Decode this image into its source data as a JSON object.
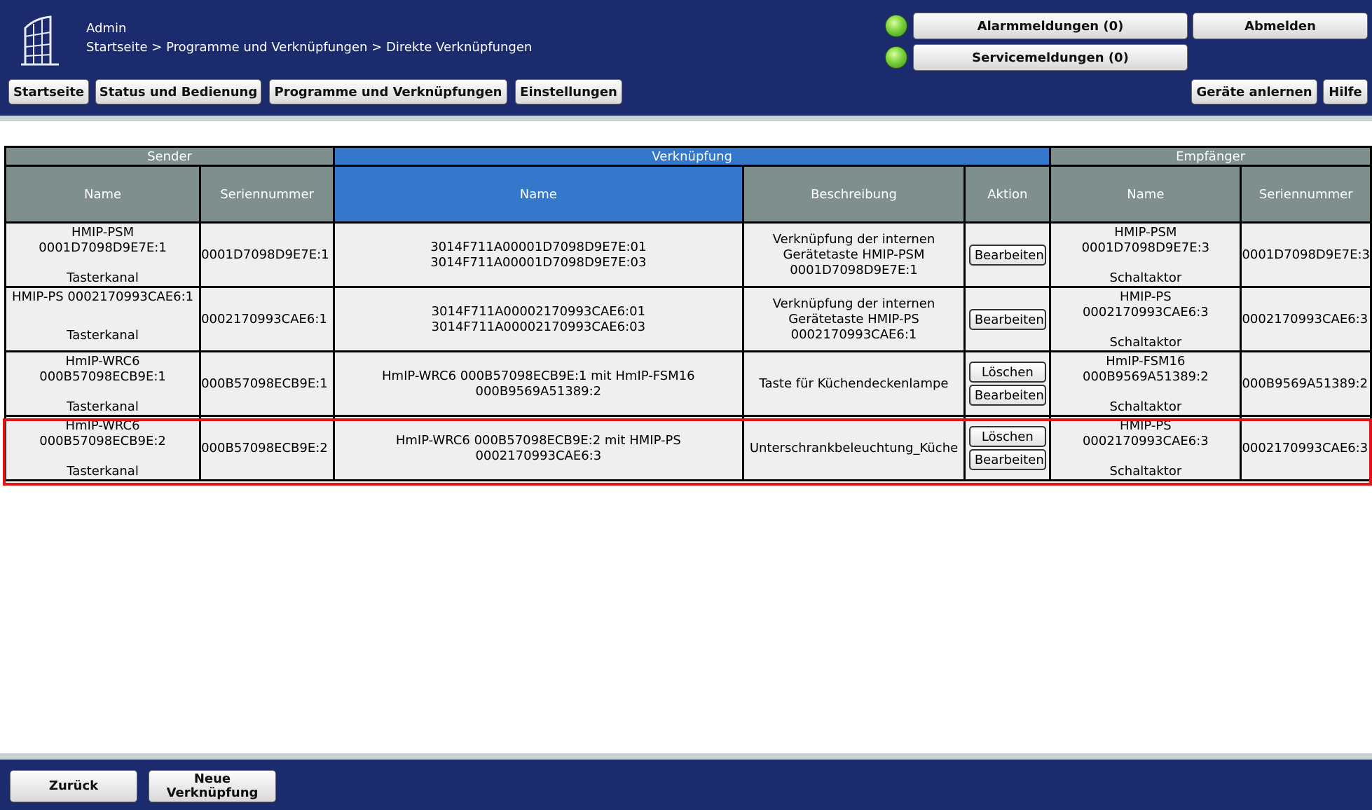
{
  "header": {
    "user": "Admin",
    "breadcrumb": "Startseite > Programme und Verknüpfungen > Direkte Verknüpfungen",
    "alarm_button": "Alarmmeldungen (0)",
    "service_button": "Servicemeldungen (0)",
    "logout_button": "Abmelden",
    "status_led_color": "#7bd23b"
  },
  "nav": {
    "home": "Startseite",
    "status": "Status und Bedienung",
    "programs": "Programme und Verknüpfungen",
    "settings": "Einstellungen",
    "teach": "Geräte anlernen",
    "help": "Hilfe"
  },
  "table": {
    "groups": {
      "sender": "Sender",
      "link": "Verknüpfung",
      "receiver": "Empfänger"
    },
    "columns": {
      "sender_name": "Name",
      "sender_serial": "Seriennummer",
      "link_name": "Name",
      "description": "Beschreibung",
      "action": "Aktion",
      "receiver_name": "Name",
      "receiver_serial": "Seriennummer"
    },
    "rows": [
      {
        "sender_name": "HMIP-PSM 0001D7098D9E7E:1",
        "sender_type": "Tasterkanal",
        "sender_serial": "0001D7098D9E7E:1",
        "link_name": "3014F711A00001D7098D9E7E:01 3014F711A00001D7098D9E7E:03",
        "description": "Verknüpfung der internen Gerätetaste HMIP-PSM 0001D7098D9E7E:1",
        "buttons": [
          "Bearbeiten"
        ],
        "receiver_name": "HMIP-PSM 0001D7098D9E7E:3",
        "receiver_type": "Schaltaktor",
        "receiver_serial": "0001D7098D9E7E:3"
      },
      {
        "sender_name": "HMIP-PS 0002170993CAE6:1",
        "sender_type": "Tasterkanal",
        "sender_serial": "0002170993CAE6:1",
        "link_name": "3014F711A00002170993CAE6:01 3014F711A00002170993CAE6:03",
        "description": "Verknüpfung der internen Gerätetaste HMIP-PS 0002170993CAE6:1",
        "buttons": [
          "Bearbeiten"
        ],
        "receiver_name": "HMIP-PS 0002170993CAE6:3",
        "receiver_type": "Schaltaktor",
        "receiver_serial": "0002170993CAE6:3"
      },
      {
        "sender_name": "HmIP-WRC6 000B57098ECB9E:1",
        "sender_type": "Tasterkanal",
        "sender_serial": "000B57098ECB9E:1",
        "link_name": "HmIP-WRC6 000B57098ECB9E:1 mit HmIP-FSM16 000B9569A51389:2",
        "description": "Taste für Küchendeckenlampe",
        "buttons": [
          "Löschen",
          "Bearbeiten"
        ],
        "receiver_name": "HmIP-FSM16 000B9569A51389:2",
        "receiver_type": "Schaltaktor",
        "receiver_serial": "000B9569A51389:2"
      },
      {
        "sender_name": "HmIP-WRC6 000B57098ECB9E:2",
        "sender_type": "Tasterkanal",
        "sender_serial": "000B57098ECB9E:2",
        "link_name": "HmIP-WRC6 000B57098ECB9E:2 mit HMIP-PS 0002170993CAE6:3",
        "description": "Unterschrankbeleuchtung_Küche",
        "buttons": [
          "Löschen",
          "Bearbeiten"
        ],
        "receiver_name": "HMIP-PS 0002170993CAE6:3",
        "receiver_type": "Schaltaktor",
        "receiver_serial": "0002170993CAE6:3",
        "highlighted": true
      }
    ]
  },
  "footer": {
    "back": "Zurück",
    "new_link": "Neue Verknüpfung"
  },
  "colors": {
    "header_bg": "#1b2b6e",
    "accent_blue": "#3477cb",
    "header_gray": "#7f8f8e",
    "highlight": "#e01414"
  }
}
